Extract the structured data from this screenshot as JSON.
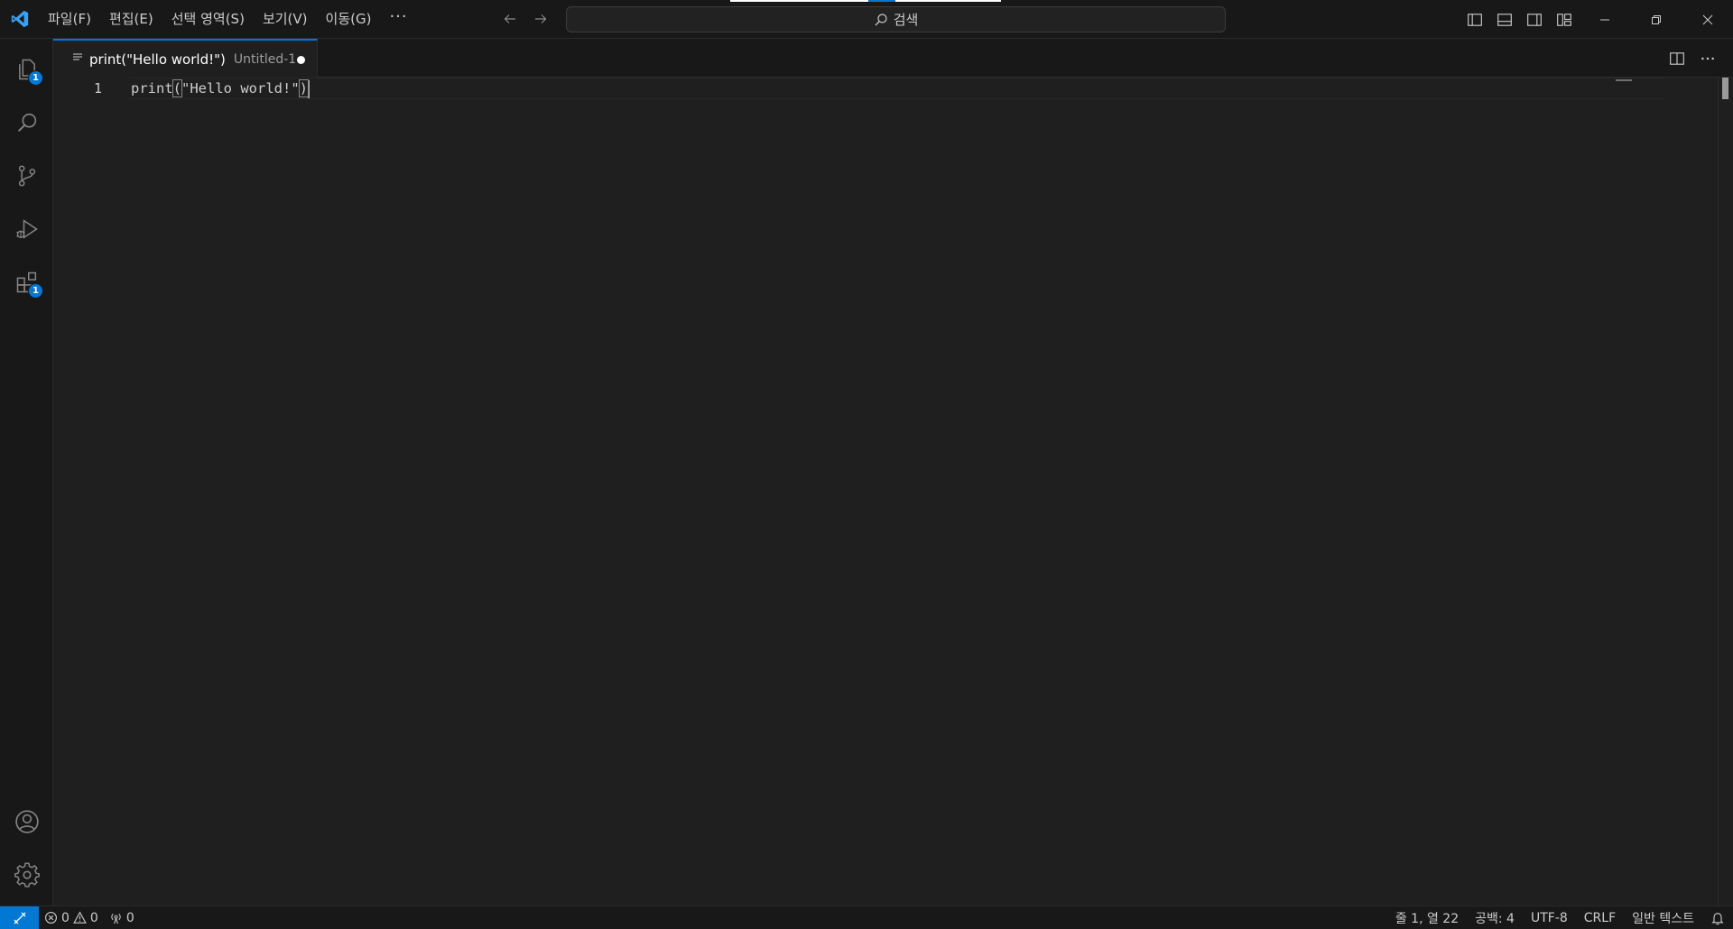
{
  "titlebar": {
    "menu": [
      {
        "label": "파일(F)"
      },
      {
        "label": "편집(E)"
      },
      {
        "label": "선택 영역(S)"
      },
      {
        "label": "보기(V)"
      },
      {
        "label": "이동(G)"
      }
    ],
    "more_label": "···",
    "search_label": "검색"
  },
  "activitybar": {
    "explorer_badge": "1",
    "extensions_badge": "1"
  },
  "editor": {
    "tab": {
      "title": "print(\"Hello world!\")",
      "description": "Untitled-1",
      "dirty": true
    },
    "lines": [
      {
        "number": "1",
        "fn": "print",
        "open_paren": "(",
        "string": "\"Hello world!\"",
        "close_paren": ")"
      }
    ]
  },
  "statusbar": {
    "errors": "0",
    "warnings": "0",
    "ports": "0",
    "cursor_position": "줄 1, 열 22",
    "indentation": "공백: 4",
    "encoding": "UTF-8",
    "eol": "CRLF",
    "language": "일반 텍스트"
  },
  "colors": {
    "accent": "#0078d4",
    "background": "#1f1f1f",
    "chrome": "#181818"
  }
}
